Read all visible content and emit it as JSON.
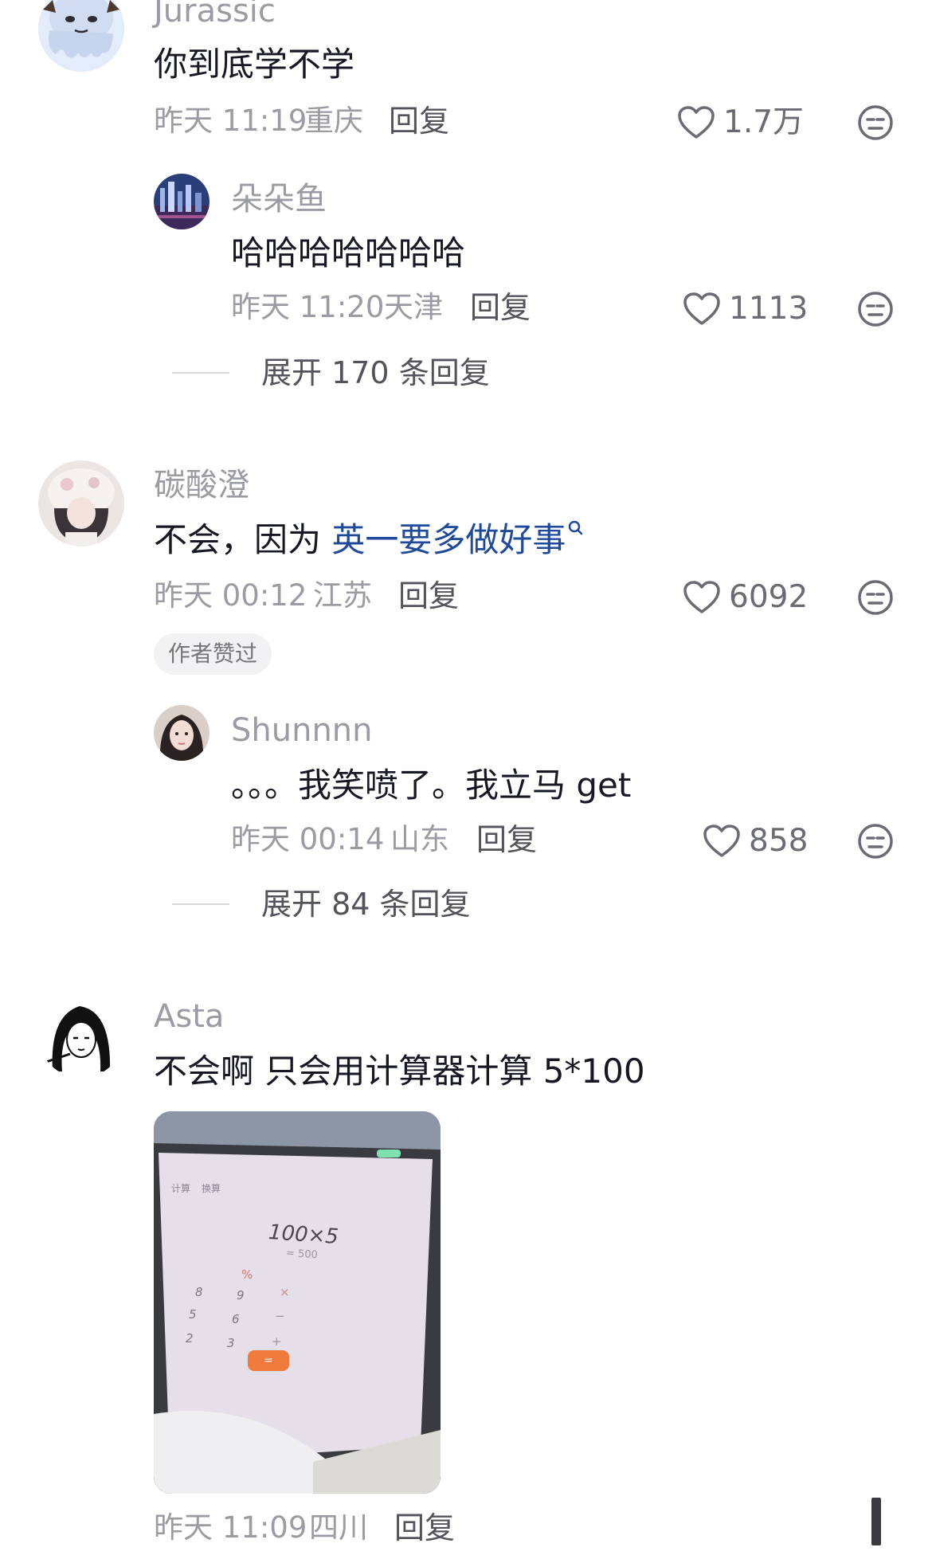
{
  "comments": [
    {
      "user": "Jurassic",
      "text": "你到底学不学",
      "time": "昨天 11:19",
      "location": "重庆",
      "reply_label": "回复",
      "likes": "1.7万",
      "replies": [
        {
          "user": "朵朵鱼",
          "text": "哈哈哈哈哈哈哈",
          "time": "昨天 11:20",
          "location": "天津",
          "reply_label": "回复",
          "likes": "1113"
        }
      ],
      "expand_label": "展开 170 条回复"
    },
    {
      "user": "碳酸澄",
      "text_prefix": "不会，因为 ",
      "text_link": "英一要多做好事",
      "link_icon": "search-icon",
      "time": "昨天 00:12",
      "location": "江苏",
      "reply_label": "回复",
      "likes": "6092",
      "badge": "作者赞过",
      "replies": [
        {
          "user": "Shunnnn",
          "text": "。。。我笑喷了。我立马 get",
          "time": "昨天 00:14",
          "location": "山东",
          "reply_label": "回复",
          "likes": "858"
        }
      ],
      "expand_label": "展开 84 条回复"
    },
    {
      "user": "Asta",
      "text": "不会啊 只会用计算器计算 5*100",
      "time": "昨天 11:09",
      "location": "四川",
      "reply_label": "回复",
      "photo": {
        "display": "100×5",
        "result": "= 500",
        "tab_labels": [
          "计算",
          "换算"
        ],
        "key_labels": [
          "8",
          "9",
          "5",
          "6",
          "2",
          "3",
          "%",
          "×",
          "−",
          "+",
          "="
        ]
      }
    }
  ],
  "colors": {
    "link": "#1f4a9a",
    "secondary_text": "#9b9ca3",
    "accent_equals": "#f07a3c"
  }
}
